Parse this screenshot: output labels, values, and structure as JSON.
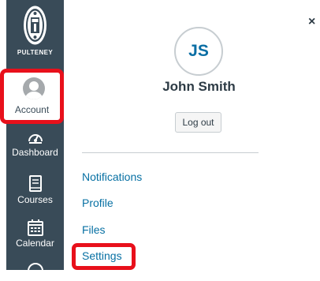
{
  "nav": {
    "logo_text": "PULTENEY",
    "account_label": "Account",
    "dashboard_label": "Dashboard",
    "courses_label": "Courses",
    "calendar_label": "Calendar"
  },
  "tray": {
    "close_glyph": "×",
    "initials": "JS",
    "user_name": "John Smith",
    "logout_label": "Log out",
    "links": {
      "notifications": "Notifications",
      "profile": "Profile",
      "files": "Files",
      "settings": "Settings"
    }
  },
  "colors": {
    "nav_bg": "#394b58",
    "link": "#0770a3",
    "highlight": "#e8101b"
  }
}
